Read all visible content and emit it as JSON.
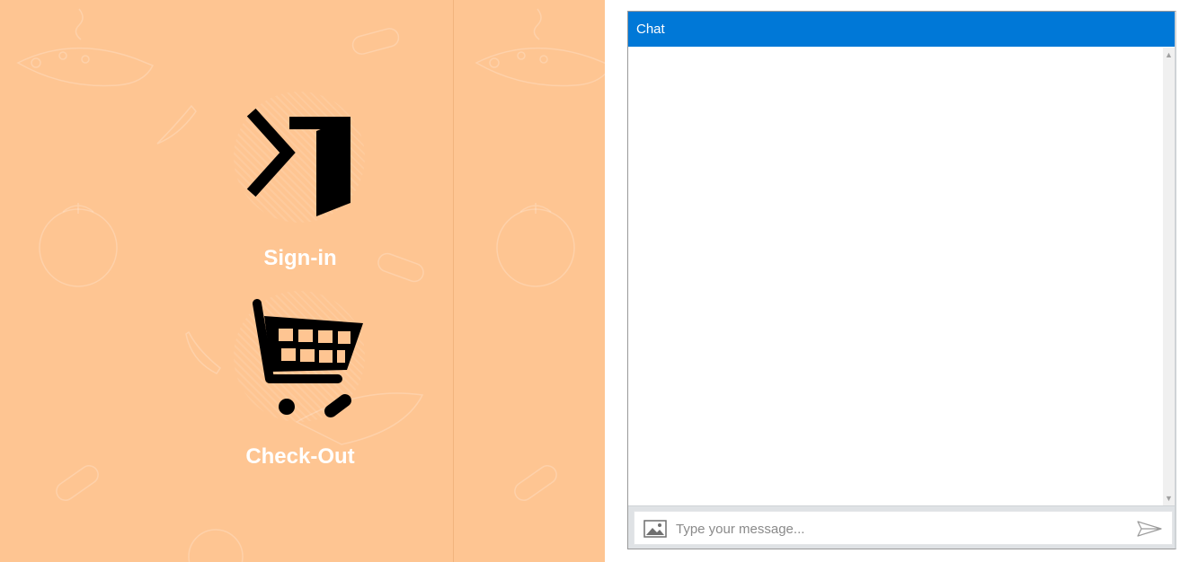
{
  "kiosk": {
    "background_color": "#fec592",
    "actions": [
      {
        "label": "Sign-in",
        "icon": "sign-in-icon"
      },
      {
        "label": "Check-Out",
        "icon": "shopping-cart-icon"
      }
    ]
  },
  "chat": {
    "title": "Chat",
    "accent_color": "#0078d7",
    "input": {
      "value": "",
      "placeholder": "Type your message..."
    },
    "icons": {
      "attach": "image-icon",
      "send": "send-icon"
    }
  }
}
